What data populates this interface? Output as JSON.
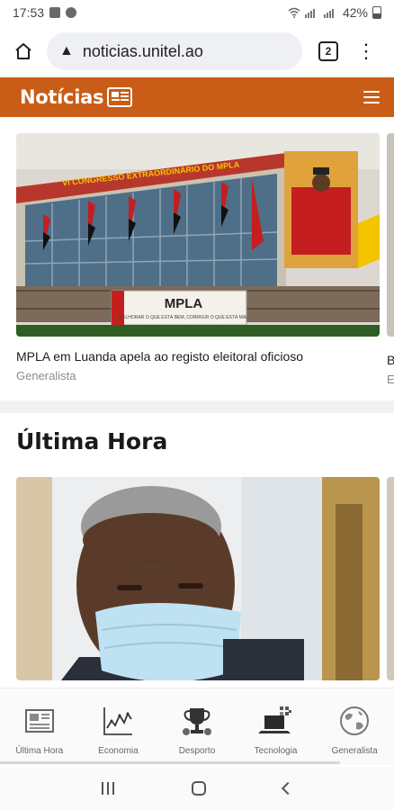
{
  "status_bar": {
    "time": "17:53",
    "battery": "42%"
  },
  "browser": {
    "url": "noticias.unitel.ao",
    "tab_count": "2",
    "menu_glyph": "⋮",
    "lock_glyph": "▲"
  },
  "site": {
    "logo": "Notícias"
  },
  "featured": {
    "title": "MPLA em Luanda apela ao registo eleitoral oficioso",
    "category": "Generalista",
    "image_banner": "VI CONGRESSO EXTRAORDINÁRIO DO MPLA",
    "image_sign_title": "MPLA",
    "image_sign_subtitle": "MELHORAR O QUE ESTÁ BEM, CORRIGIR O QUE ESTÁ MAL",
    "next_title": "B",
    "next_category": "E"
  },
  "section": {
    "title": "Última Hora"
  },
  "bottom_nav": {
    "items": [
      {
        "label": "Última Hora",
        "icon": "newspaper-icon"
      },
      {
        "label": "Economia",
        "icon": "line-chart-icon"
      },
      {
        "label": "Desporto",
        "icon": "trophy-icon"
      },
      {
        "label": "Tecnologia",
        "icon": "laptop-icon"
      },
      {
        "label": "Generalista",
        "icon": "globe-icon"
      }
    ]
  },
  "colors": {
    "brand": "#c95c16"
  }
}
